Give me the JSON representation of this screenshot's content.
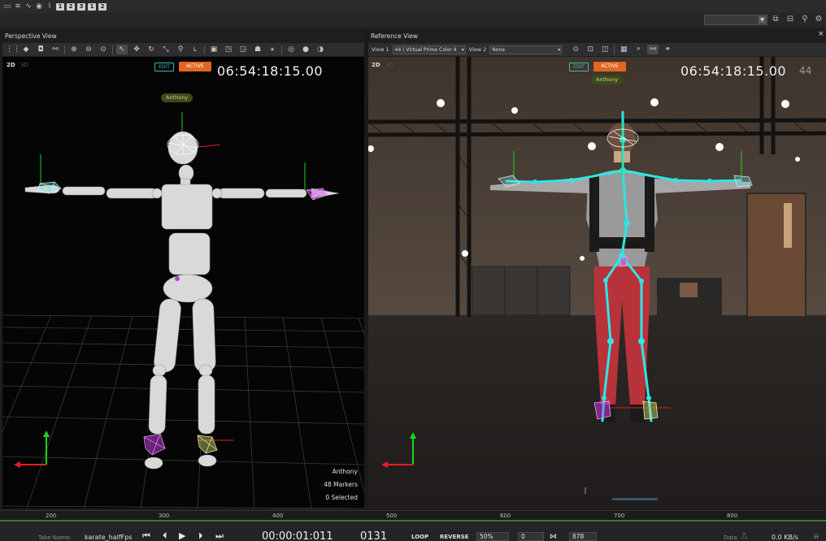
{
  "top_toolbar": {
    "numbered_buttons": [
      "1",
      "2",
      "3",
      "1",
      "2"
    ]
  },
  "left_pane": {
    "title": "Perspective View",
    "mode_2d": "2D",
    "mode_3d": "3D",
    "edit_badge": "EDIT",
    "active_badge": "ACTIVE",
    "timecode": "06:54:18:15.00",
    "actor_tag": "Anthony",
    "info": {
      "name": "Anthony",
      "markers": "48 Markers",
      "selected": "0 Selected"
    }
  },
  "right_pane": {
    "title": "Reference View",
    "close": "×",
    "view1_label": "View 1",
    "view1_value": "44  ( Virtual Prime Color 4",
    "view2_label": "View 2",
    "view2_value": "None",
    "mode_2d": "2D",
    "mode_3d": "3D",
    "edit_badge": "EDIT",
    "active_badge": "ACTIVE",
    "actor_tag": "Anthony",
    "timecode": "06:54:18:15.00",
    "camera_number": "44"
  },
  "timeline": {
    "ticks": [
      "200",
      "300",
      "400",
      "500",
      "600",
      "700",
      "800"
    ]
  },
  "transport": {
    "take_name_label": "Take Name:",
    "take_name_value": "karate_halfFps",
    "time": "00:00:01:011",
    "frame": "0131",
    "loop": "LOOP",
    "reverse": "REVERSE",
    "speed": "50%",
    "start_frame": "0",
    "end_frame": "878",
    "data_label": "Data",
    "data_rate": "0.0 KB/s"
  },
  "colors": {
    "active_orange": "#e1661f",
    "edit_teal": "#3fb9b3",
    "skeleton_cyan": "#2ee6e6",
    "marker_magenta": "#d23cf0",
    "axis_green": "#1fd31f",
    "axis_red": "#e02020"
  }
}
